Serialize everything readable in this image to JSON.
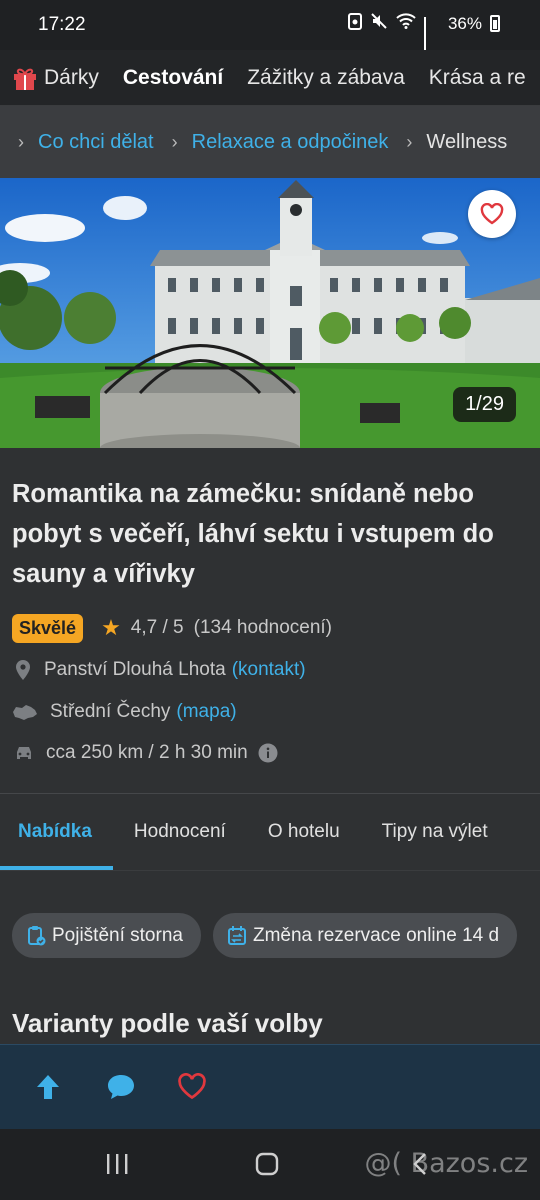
{
  "status_bar": {
    "time": "17:22",
    "battery": "36%"
  },
  "categories": {
    "items": [
      {
        "label": "Dárky",
        "active": false
      },
      {
        "label": "Cestování",
        "active": true
      },
      {
        "label": "Zážitky a zábava",
        "active": false
      },
      {
        "label": "Krása a re",
        "active": false
      }
    ]
  },
  "breadcrumb": {
    "items": [
      "Co chci dělat",
      "Relaxace a odpočinek"
    ],
    "current": "Wellness"
  },
  "gallery": {
    "counter": "1/29"
  },
  "offer": {
    "title": "Romantika na zámečku: snídaně nebo pobyt s večeří, láhví sektu i vstupem do sauny a vířivky",
    "badge": "Skvělé",
    "rating": "4,7 / 5",
    "reviews": "(134 hodnocení)",
    "location": "Panství Dlouhá Lhota",
    "location_link": "(kontakt)",
    "region": "Střední Čechy",
    "region_link": "(mapa)",
    "distance": "cca 250 km / 2 h 30 min"
  },
  "tabs": [
    {
      "label": "Nabídka",
      "active": true
    },
    {
      "label": "Hodnocení",
      "active": false
    },
    {
      "label": "O hotelu",
      "active": false
    },
    {
      "label": "Tipy na výlet",
      "active": false
    }
  ],
  "chips": [
    "Pojištění storna",
    "Změna rezervace online 14 d"
  ],
  "section_heading": "Varianty podle vaší volby",
  "watermark": "@( Bazos.cz",
  "colors": {
    "accent": "#3fb1e8",
    "badge": "#f5a623",
    "heart": "#e0383e"
  }
}
